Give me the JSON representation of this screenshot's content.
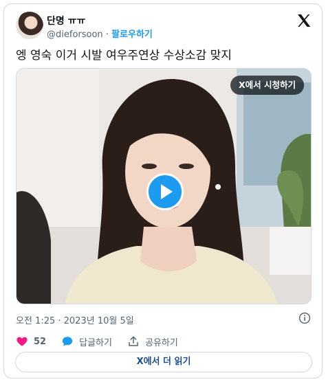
{
  "user": {
    "name": "단명 ㅠㅠ",
    "handle": "@dieforsoon",
    "separator": "·",
    "follow_label": "팔로우하기"
  },
  "tweet": {
    "text": "엥 영숙 이거 시발 여우주연상 수상소감 맞지"
  },
  "media": {
    "watch_label": "X에서 시청하기"
  },
  "meta": {
    "timestamp": "오전 1:25 · 2023년 10월 5일"
  },
  "actions": {
    "like_count": "52",
    "reply_label": "답글하기",
    "share_label": "공유하기"
  },
  "read_more_label": "X에서 더 읽기",
  "colors": {
    "accent": "#1d9bf0",
    "like": "#f91880",
    "text": "#0f1419",
    "muted": "#536471",
    "border": "#cfd9de"
  }
}
